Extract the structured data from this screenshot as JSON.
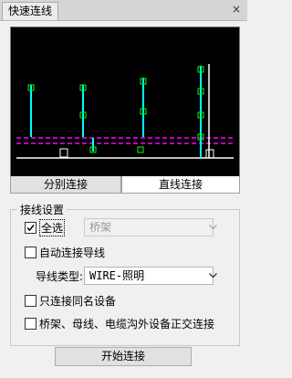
{
  "window": {
    "title": "快速连线",
    "close_glyph": "×"
  },
  "tabs": [
    {
      "label": "分别连接",
      "active": false
    },
    {
      "label": "直线连接",
      "active": true
    }
  ],
  "settings": {
    "group_title": "接线设置",
    "select_all": {
      "label": "全选",
      "checked": true
    },
    "bridge_combo": {
      "value": "桥架",
      "enabled": false
    },
    "auto_connect": {
      "label": "自动连接导线",
      "checked": false
    },
    "wire_type": {
      "label": "导线类型:",
      "value": "WIRE-照明"
    },
    "same_name_only": {
      "label": "只连接同名设备",
      "checked": false
    },
    "orthogonal": {
      "label": "桥架、母线、电缆沟外设备正交连接",
      "checked": false
    }
  },
  "start_button": {
    "label": "开始连接"
  },
  "colors": {
    "preview_bg": "#000000",
    "device_line": "#00ffff",
    "bus_line": "#ff00ff",
    "device_mark": "#00ff00",
    "ground_line": "#ffffff"
  },
  "icons": {
    "close": "close-icon",
    "dropdown": "chevron-down-icon",
    "check": "check-icon"
  }
}
